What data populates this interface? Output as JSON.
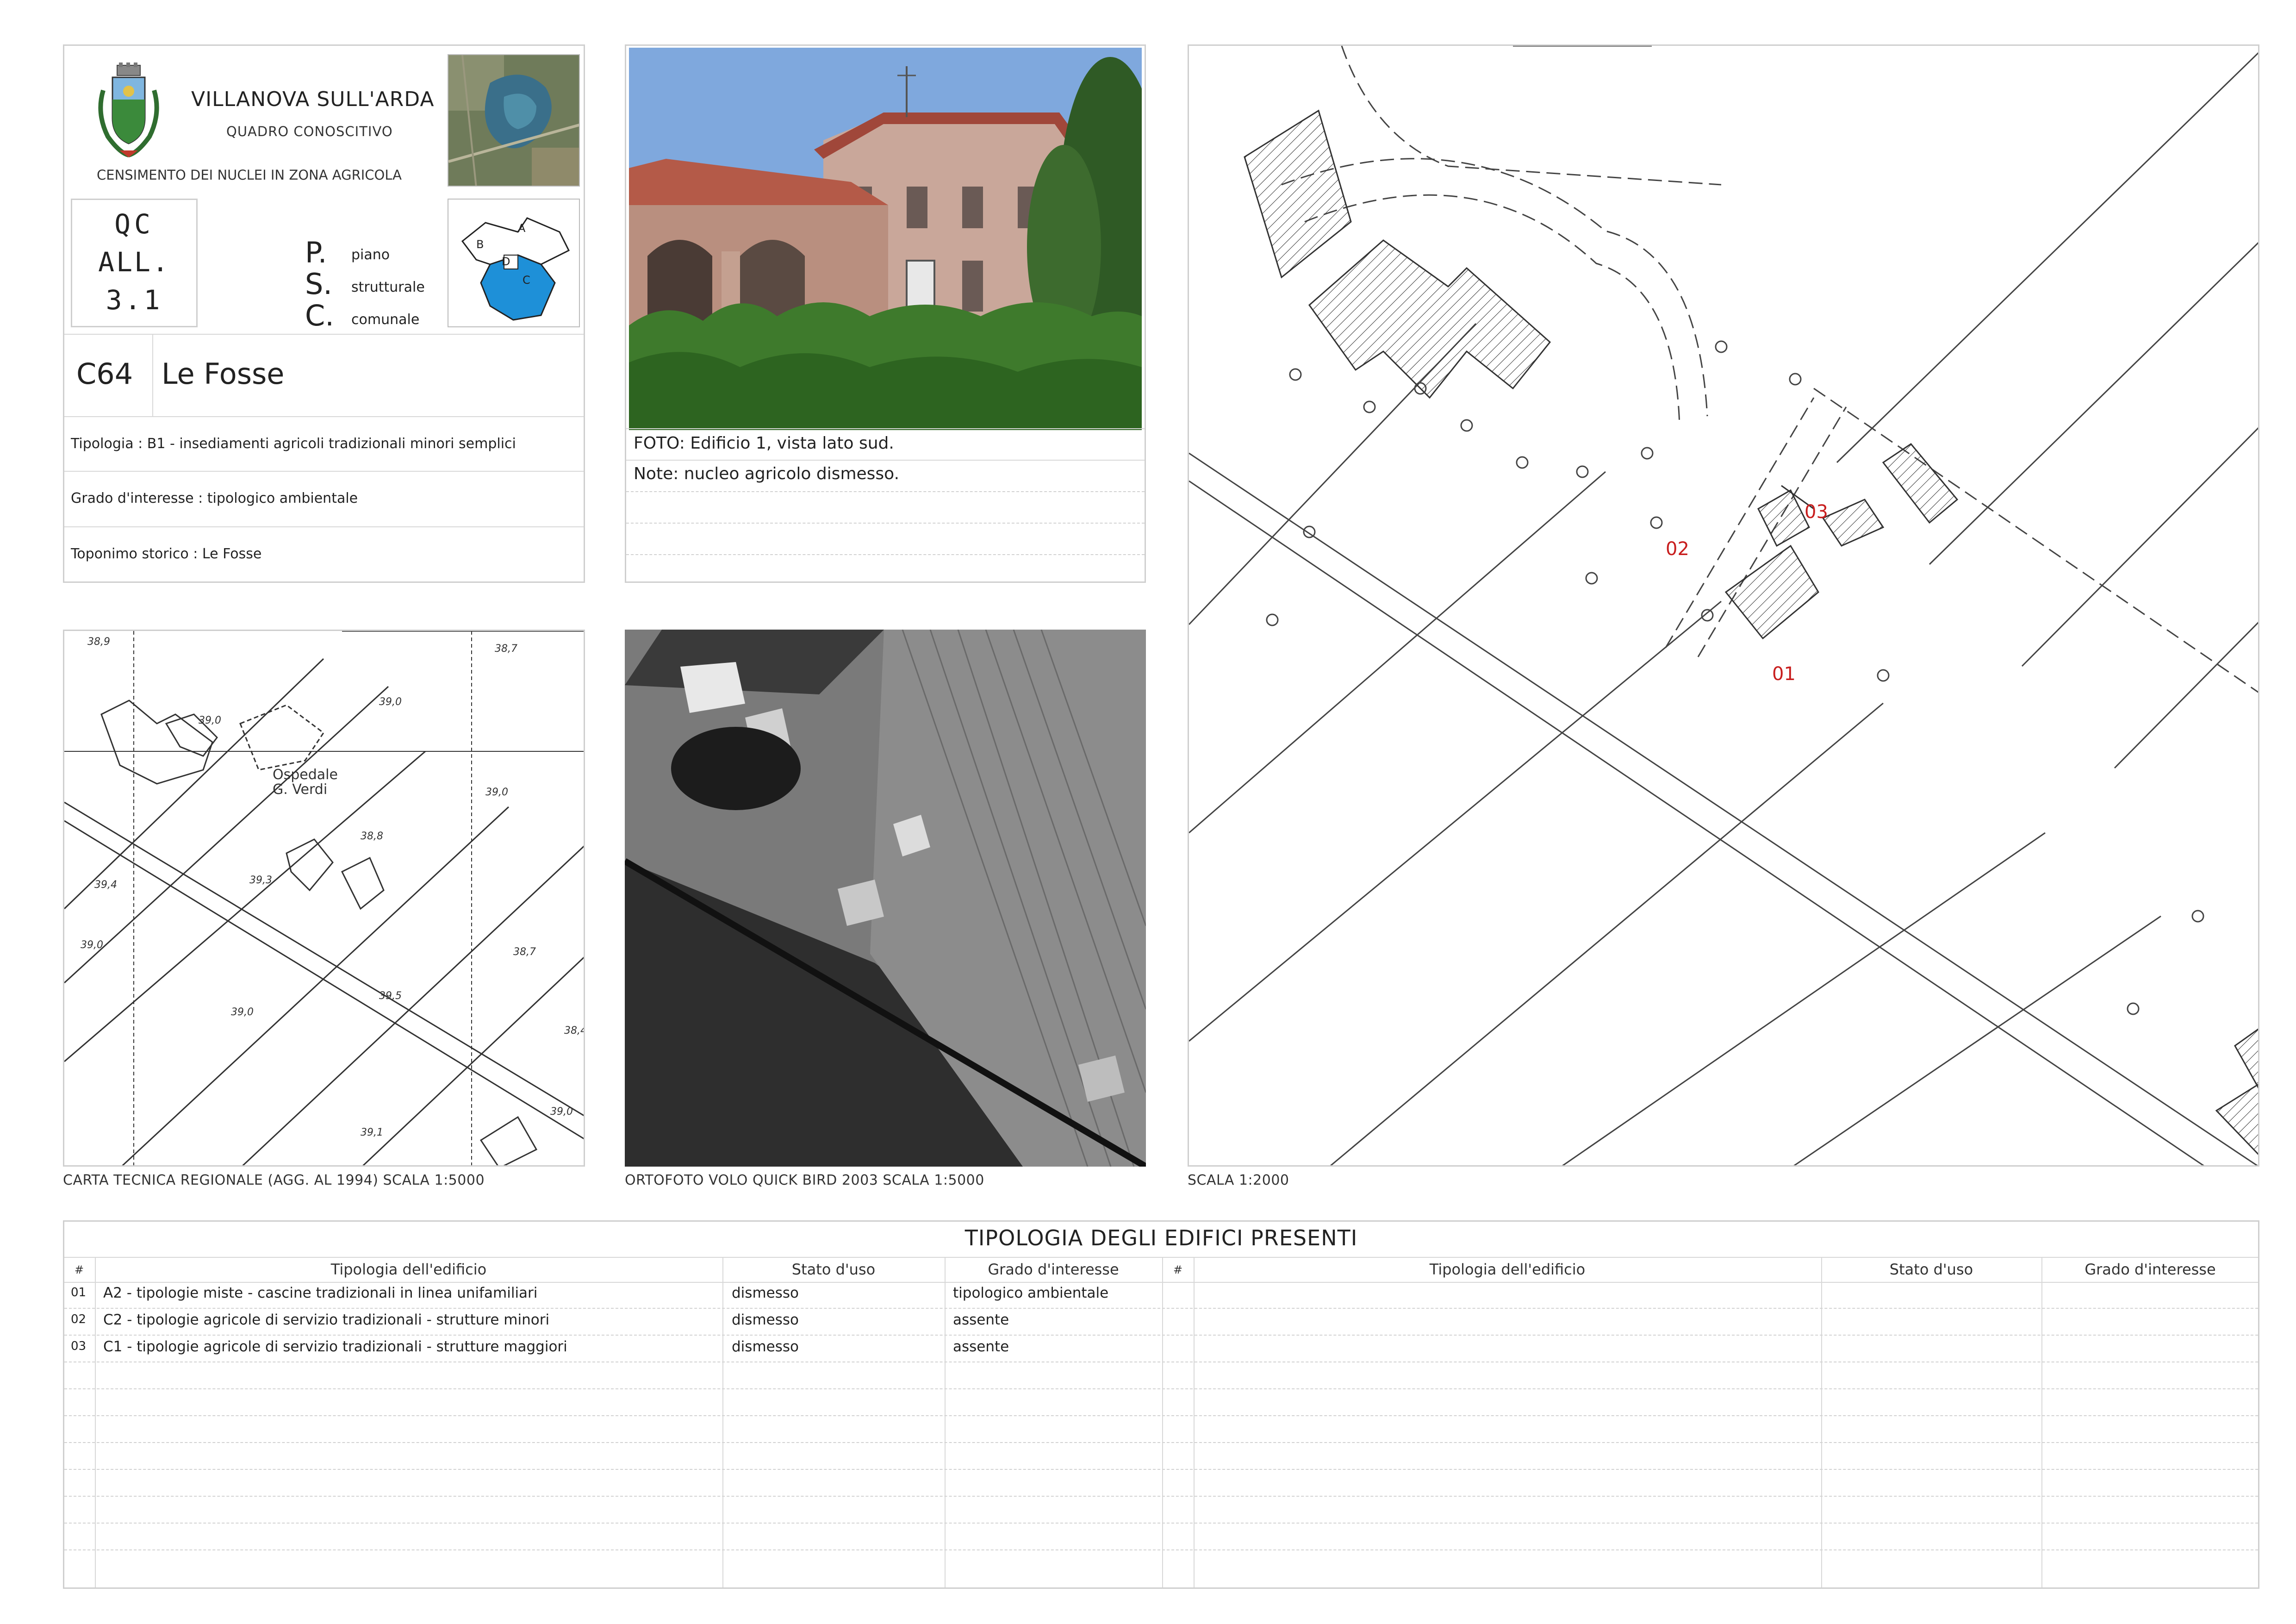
{
  "header": {
    "municipality": "VILLANOVA SULL'ARDA",
    "subtitle": "QUADRO CONOSCITIVO",
    "census": "CENSIMENTO DEI NUCLEI IN ZONA AGRICOLA",
    "qc_lines": [
      "QC",
      "ALL.",
      "3.1"
    ],
    "psc_letters": [
      "P.",
      "S.",
      "C."
    ],
    "psc_words": [
      "piano",
      "strutturale",
      "comunale"
    ],
    "zone_labels": [
      "A",
      "B",
      "C",
      "D"
    ]
  },
  "record": {
    "code": "C64",
    "name": "Le Fosse",
    "tipologia": "Tipologia : B1 - insediamenti agricoli tradizionali minori semplici",
    "grado": "Grado d'interesse : tipologico ambientale",
    "toponimo": "Toponimo storico : Le Fosse"
  },
  "photo": {
    "caption": "FOTO: Edificio 1, vista lato sud.",
    "note": "Note: nucleo agricolo dismesso."
  },
  "maps": {
    "ctr_caption": "CARTA TECNICA REGIONALE (AGG. AL 1994) SCALA 1:5000",
    "ortho_caption": "ORTOFOTO VOLO QUICK BIRD 2003 SCALA 1:5000",
    "plan_caption": "SCALA 1:2000",
    "ctr_labels": [
      "38,9",
      "38,7",
      "39,0",
      "39,0",
      "39,0",
      "38,8",
      "39,4",
      "39,3",
      "38,7",
      "39,0",
      "39,5",
      "39,0",
      "38,4",
      "39,0",
      "39,1"
    ],
    "ctr_place": [
      "Ospedale",
      "G. Verdi"
    ],
    "plan_building_labels": [
      "01",
      "02",
      "03"
    ]
  },
  "table": {
    "title": "TIPOLOGIA DEGLI EDIFICI PRESENTI",
    "headers": [
      "#",
      "Tipologia dell'edificio",
      "Stato d'uso",
      "Grado d'interesse"
    ],
    "rows": [
      {
        "n": "01",
        "tipologia": "A2 - tipologie miste - cascine tradizionali in linea unifamiliari",
        "stato": "dismesso",
        "grado": "tipologico ambientale"
      },
      {
        "n": "02",
        "tipologia": "C2 - tipologie agricole di servizio tradizionali - strutture minori",
        "stato": "dismesso",
        "grado": "assente"
      },
      {
        "n": "03",
        "tipologia": "C1 - tipologie agricole di servizio tradizionali - strutture maggiori",
        "stato": "dismesso",
        "grado": "assente"
      }
    ]
  },
  "colors": {
    "accent_blue": "#1e90d8",
    "label_red": "#c81e1e",
    "frame_gray": "#cfcfcf"
  }
}
